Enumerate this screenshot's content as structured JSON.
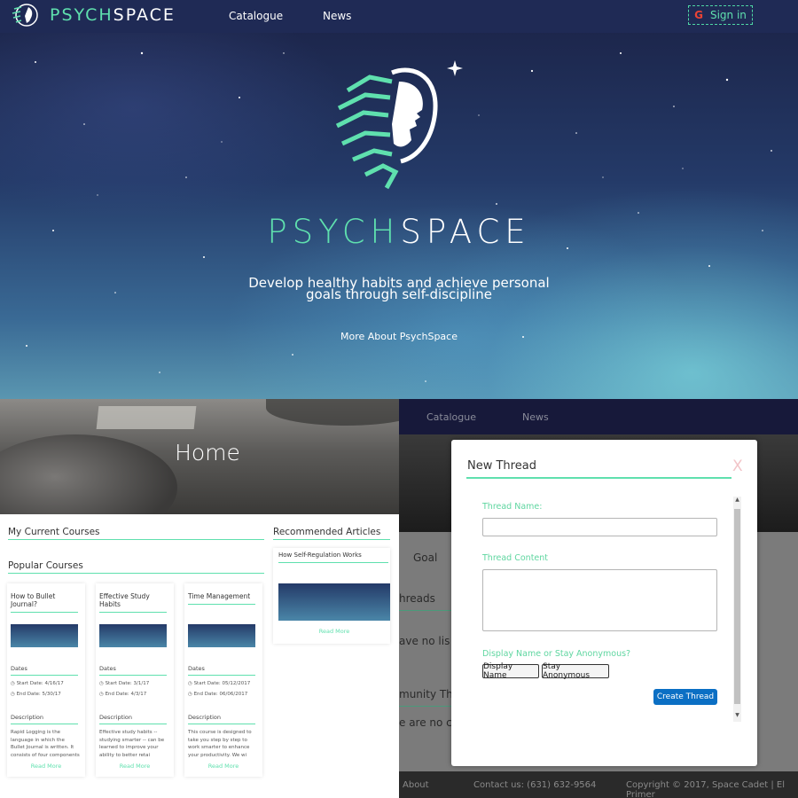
{
  "hero": {
    "brand_left": "PSYCH",
    "brand_right": "SPACE",
    "nav": [
      "Catalogue",
      "News"
    ],
    "signin_label": "Sign in",
    "google_glyph": "G",
    "tagline_line1": "Develop healthy habits and achieve personal",
    "tagline_line2": "goals through self-discipline",
    "more_link": "More About PsychSpace"
  },
  "home": {
    "title": "Home",
    "my_courses_heading": "My Current Courses",
    "popular_heading": "Popular Courses",
    "articles_heading": "Recommended Articles",
    "courses": [
      {
        "title": "How to Bullet Journal?",
        "dates_label": "Dates",
        "start": "Start Date: 4/16/17",
        "end": "End Date: 5/30/17",
        "desc_label": "Description",
        "desc": "Rapid Logging is the language in which the Bullet Journal is written. It consists of four components",
        "read_more": "Read More"
      },
      {
        "title": "Effective Study Habits",
        "dates_label": "Dates",
        "start": "Start Date: 3/1/17",
        "end": "End Date: 4/3/17",
        "desc_label": "Description",
        "desc": "Effective study habits -- studying smarter -- can be learned to improve your ability to better retai",
        "read_more": "Read More"
      },
      {
        "title": "Time Management",
        "dates_label": "Dates",
        "start": "Start Date: 05/12/2017",
        "end": "End Date: 06/06/2017",
        "desc_label": "Description",
        "desc": "This course is designed to take you step by step to work smarter to enhance your productivity. We wi",
        "read_more": "Read More"
      }
    ],
    "article": {
      "title": "How Self-Regulation Works",
      "read_more": "Read More"
    }
  },
  "forum": {
    "nav": [
      "Catalogue",
      "News"
    ],
    "goal_tab": "Goal",
    "threads_heading": "hreads",
    "no_list_text": "ave no lis",
    "community_heading": "munity Th",
    "no_content_text": "e are no co",
    "footer_about": "About",
    "footer_contact": "Contact us: (631) 632-9564",
    "footer_copyright": "Copyright © 2017, Space Cadet | El Primer"
  },
  "modal": {
    "title": "New Thread",
    "close_label": "X",
    "thread_name_label": "Thread Name:",
    "thread_name_value": "",
    "thread_content_label": "Thread Content",
    "thread_content_value": "",
    "display_question": "Display Name or Stay Anonymous?",
    "display_name_button": "Display Name",
    "stay_anon_button": "Stay Anonymous",
    "create_button": "Create Thread",
    "scroll_up": "▲",
    "scroll_down": "▼"
  },
  "colors": {
    "accent": "#5fe0ae",
    "nav_bg": "#1f2a55",
    "primary_button": "#0b6fc4",
    "close_x": "#f2c4c8"
  },
  "icons": [
    "psychspace-logo-icon",
    "google-icon",
    "clock-icon",
    "scrollbar-arrow-icon"
  ]
}
